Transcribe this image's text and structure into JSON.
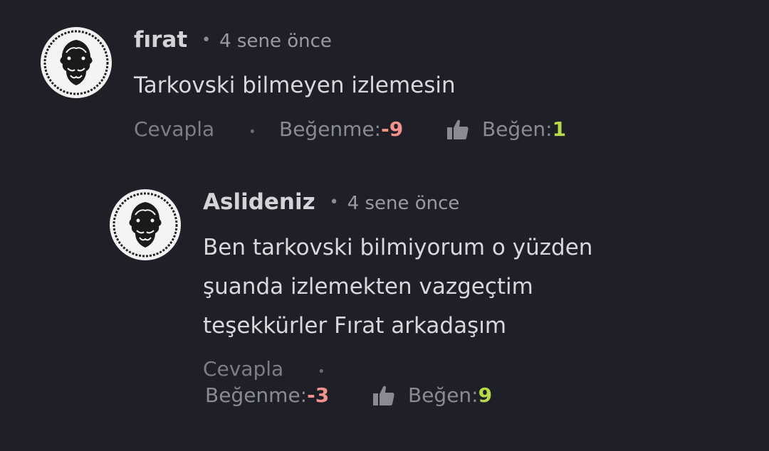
{
  "comments": [
    {
      "username": "fırat",
      "separator": "•",
      "time": "4 sene önce",
      "text": "Tarkovski bilmeyen izlemesin",
      "reply_label": "Cevapla",
      "action_separator": "•",
      "dislike_label": "Beğenme: ",
      "dislike_count": "-9",
      "like_icon": "thumbs-up-icon",
      "like_label": "Beğen: ",
      "like_count": "1"
    },
    {
      "username": "Aslideniz",
      "separator": "•",
      "time": "4 sene önce",
      "text_lines": [
        "Ben tarkovski bilmiyorum o yüzden",
        "şuanda izlemekten vazgeçtim",
        "teşekkürler Fırat arkadaşım"
      ],
      "reply_label": "Cevapla",
      "action_separator": "•",
      "dislike_label": "Beğenme: ",
      "dislike_count": "-3",
      "like_icon": "thumbs-up-icon",
      "like_label": "Beğen: ",
      "like_count": "9"
    }
  ],
  "avatar_icon": "janus-coin-avatar",
  "colors": {
    "background": "#1e1f27",
    "negative": "#f2928f",
    "positive": "#b8d94a"
  }
}
